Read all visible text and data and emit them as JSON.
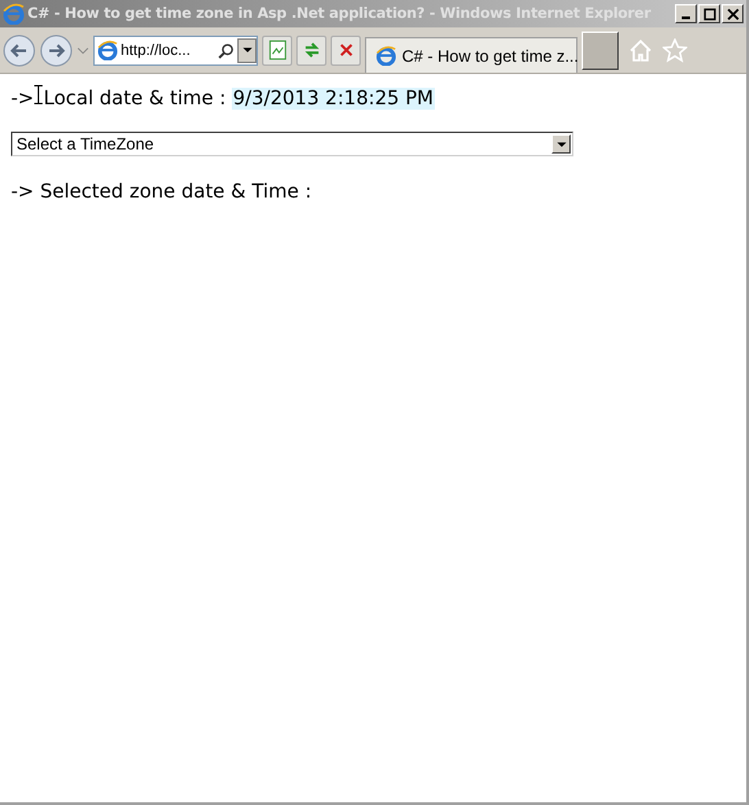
{
  "window": {
    "title": "C# - How to get time zone in Asp .Net application? - Windows Internet Explorer"
  },
  "toolbar": {
    "address": "http://loc...",
    "tabs": [
      {
        "label": "C# - How to get time z...",
        "selected": true
      }
    ]
  },
  "page": {
    "local_arrow": "->",
    "local_label": "Local date & time :",
    "local_value": "9/3/2013 2:18:25 PM",
    "dropdown": {
      "value": "Select a TimeZone"
    },
    "selected_label": "-> Selected zone date & Time :"
  }
}
